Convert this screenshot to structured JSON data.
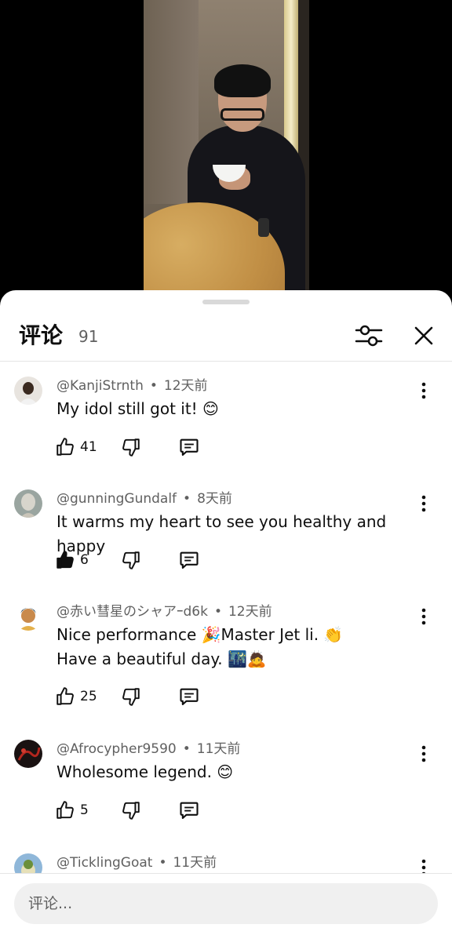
{
  "sheet": {
    "title": "评论",
    "count": "91",
    "filter_icon": "sliders-icon",
    "close_icon": "close-icon"
  },
  "comments": [
    {
      "author": "@KanjiStrnth",
      "time": "12天前",
      "text": "My idol still got it! 😊",
      "likes": "41",
      "liked": false
    },
    {
      "author": "@gunningGundalf",
      "time": "8天前",
      "text": "It warms my heart to see you healthy and happy",
      "likes": "6",
      "liked": true
    },
    {
      "author": "@赤い彗星のシャアｰd6k",
      "time": "12天前",
      "text_line1": "Nice performance 🎉Master Jet li. 👏",
      "text_line2": "Have a beautiful day. 🌃🙇",
      "likes": "25",
      "liked": false
    },
    {
      "author": "@Afrocypher9590",
      "time": "11天前",
      "text": "Wholesome legend. 😊",
      "likes": "5",
      "liked": false
    },
    {
      "author": "@TicklingGoat",
      "time": "11天前"
    }
  ],
  "input": {
    "placeholder": "评论..."
  },
  "colors": {
    "sheet_bg": "#ffffff",
    "text_primary": "#0f0f0f",
    "text_secondary": "#606060",
    "input_bg": "#f0f0f0"
  }
}
